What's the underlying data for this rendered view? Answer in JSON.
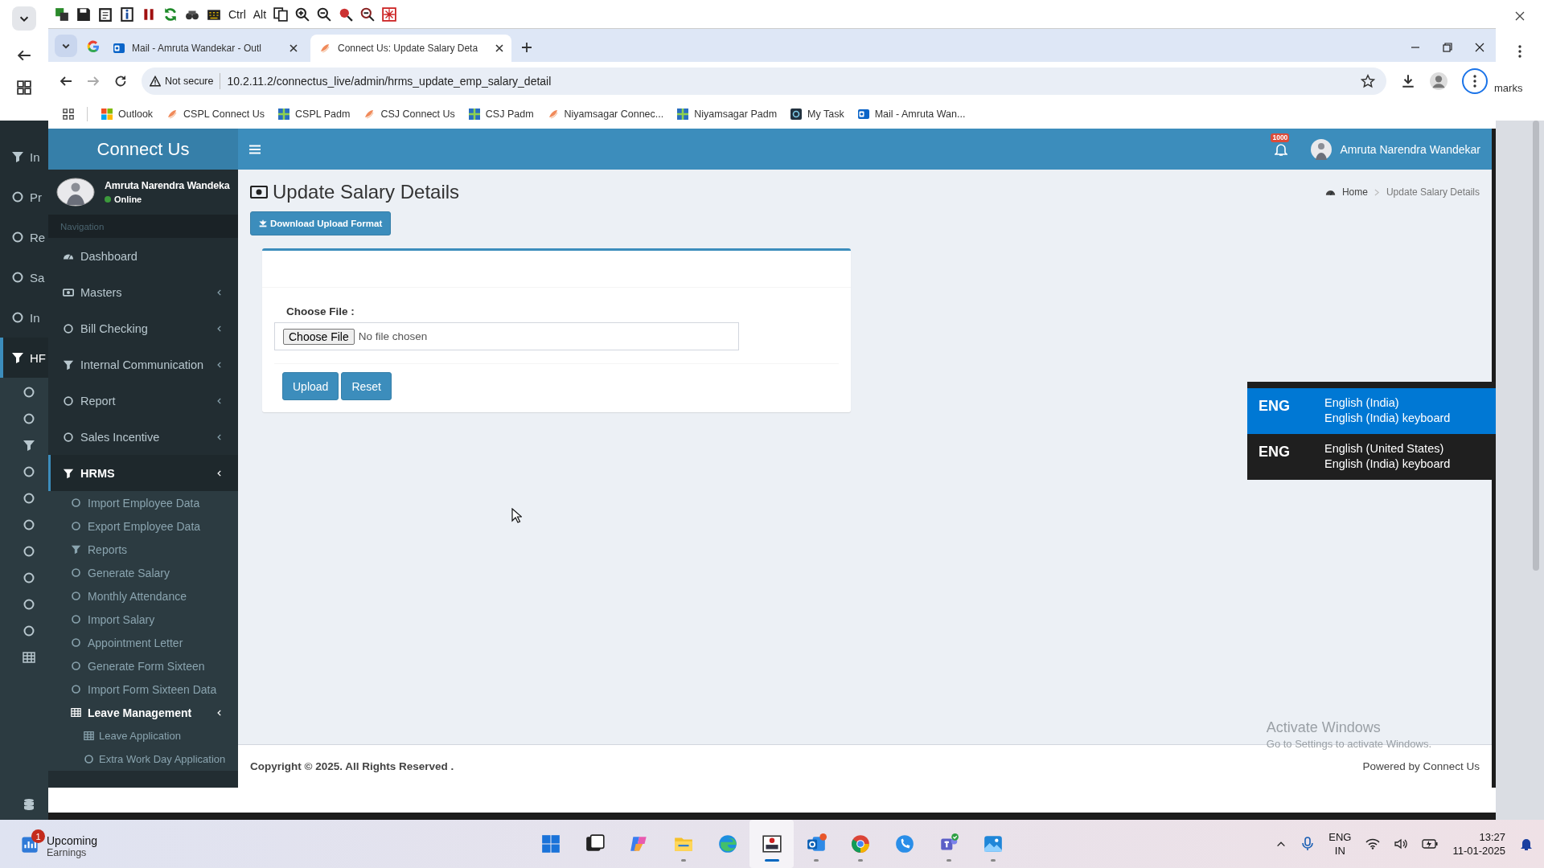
{
  "remote_toolbar": {
    "key_labels": [
      "Ctrl",
      "Alt"
    ]
  },
  "background_app": {
    "bookmarks_fragment": "marks",
    "nav_items": [
      {
        "label": "In",
        "kind": "filter",
        "selected": false
      },
      {
        "label": "Pr",
        "kind": "circle",
        "selected": false
      },
      {
        "label": "Re",
        "kind": "circle",
        "selected": false
      },
      {
        "label": "Sa",
        "kind": "circle",
        "selected": false
      },
      {
        "label": "In",
        "kind": "circle",
        "selected": false
      },
      {
        "label": "HF",
        "kind": "filter",
        "selected": true
      }
    ]
  },
  "browser": {
    "tabs": [
      {
        "title": "Mail - Amruta Wandekar - Outl",
        "kind": "mail",
        "selected": false
      },
      {
        "title": "Connect Us: Update Salary Deta",
        "kind": "site",
        "selected": true
      }
    ],
    "security_label": "Not secure",
    "url": "10.2.11.2/connectus_live/admin/hrms_update_emp_salary_detail",
    "bookmarks": [
      {
        "label": "Outlook",
        "kind": "ms"
      },
      {
        "label": "CSPL Connect Us",
        "kind": "site"
      },
      {
        "label": "CSPL Padm",
        "kind": "puzzle"
      },
      {
        "label": "CSJ Connect Us",
        "kind": "site"
      },
      {
        "label": "CSJ Padm",
        "kind": "puzzle"
      },
      {
        "label": "Niyamsagar Connec...",
        "kind": "site"
      },
      {
        "label": "Niyamsagar Padm",
        "kind": "puzzle"
      },
      {
        "label": "My Task",
        "kind": "task"
      },
      {
        "label": "Mail - Amruta Wan...",
        "kind": "mail"
      }
    ]
  },
  "app": {
    "logo": "Connect Us",
    "user_name": "Amruta Narendra Wandeka",
    "user_status": "Online",
    "nav_header": "Navigation",
    "menu": [
      {
        "label": "Dashboard",
        "kind": "dashboard",
        "selected": false
      },
      {
        "label": "Masters",
        "kind": "money",
        "selected": false,
        "expanded": false
      },
      {
        "label": "Bill Checking",
        "kind": "circle",
        "selected": false,
        "expanded": false
      },
      {
        "label": "Internal Communication",
        "kind": "filter",
        "selected": false,
        "expanded": false
      },
      {
        "label": "Report",
        "kind": "circle",
        "selected": false,
        "expanded": false
      },
      {
        "label": "Sales Incentive",
        "kind": "circle",
        "selected": false,
        "expanded": false
      },
      {
        "label": "HRMS",
        "kind": "filter",
        "selected": true,
        "expanded": true,
        "children": [
          {
            "label": "Import Employee Data",
            "kind": "circle"
          },
          {
            "label": "Export Employee Data",
            "kind": "circle"
          },
          {
            "label": "Reports",
            "kind": "filter"
          },
          {
            "label": "Generate Salary",
            "kind": "circle"
          },
          {
            "label": "Monthly Attendance",
            "kind": "circle"
          },
          {
            "label": "Import Salary",
            "kind": "circle"
          },
          {
            "label": "Appointment Letter",
            "kind": "circle"
          },
          {
            "label": "Generate Form Sixteen",
            "kind": "circle"
          },
          {
            "label": "Import Form Sixteen Data",
            "kind": "circle"
          },
          {
            "label": "Leave Management",
            "kind": "table",
            "expanded": true,
            "children": [
              {
                "label": "Leave Application",
                "kind": "table"
              },
              {
                "label": "Extra Work Day Application",
                "kind": "circle"
              }
            ]
          }
        ]
      }
    ],
    "notification_count": "1000",
    "header_user": "Amruta Narendra Wandekar",
    "page_title": "Update Salary Details",
    "breadcrumb": [
      {
        "label": "Home"
      },
      {
        "label": "Update Salary Details"
      }
    ],
    "download_button": "Download Upload Format",
    "file_label": "Choose File :",
    "file_button": "Choose File",
    "file_status": "No file chosen",
    "actions": [
      "Upload",
      "Reset"
    ],
    "footer_left": "Copyright © 2025. All Rights Reserved .",
    "footer_right": "Powered by Connect Us"
  },
  "activation_notice": {
    "title": "Activate Windows",
    "hint": "Go to Settings to activate Windows."
  },
  "input_switcher": [
    {
      "code": "ENG",
      "language": "English (India)",
      "keyboard": "English (India) keyboard",
      "selected": true
    },
    {
      "code": "ENG",
      "language": "English (United States)",
      "keyboard": "English (India) keyboard",
      "selected": false
    }
  ],
  "taskbar": {
    "widget": {
      "badge": "1",
      "title": "Upcoming",
      "subtitle": "Earnings"
    },
    "apps": [
      {
        "kind": "start",
        "running": false,
        "active": false
      },
      {
        "kind": "taskview",
        "running": false,
        "active": false
      },
      {
        "kind": "copilot",
        "running": false,
        "active": false
      },
      {
        "kind": "explorer",
        "running": true,
        "active": false
      },
      {
        "kind": "edge",
        "running": false,
        "active": false
      },
      {
        "kind": "vnc",
        "running": true,
        "active": true
      },
      {
        "kind": "outlook",
        "running": true,
        "active": false
      },
      {
        "kind": "chrome",
        "running": true,
        "active": false
      },
      {
        "kind": "phone",
        "running": false,
        "active": false
      },
      {
        "kind": "teams",
        "running": true,
        "active": false
      },
      {
        "kind": "photos",
        "running": true,
        "active": false
      }
    ],
    "language": [
      "ENG",
      "IN"
    ],
    "time": "13:27",
    "date": "11-01-2025"
  }
}
